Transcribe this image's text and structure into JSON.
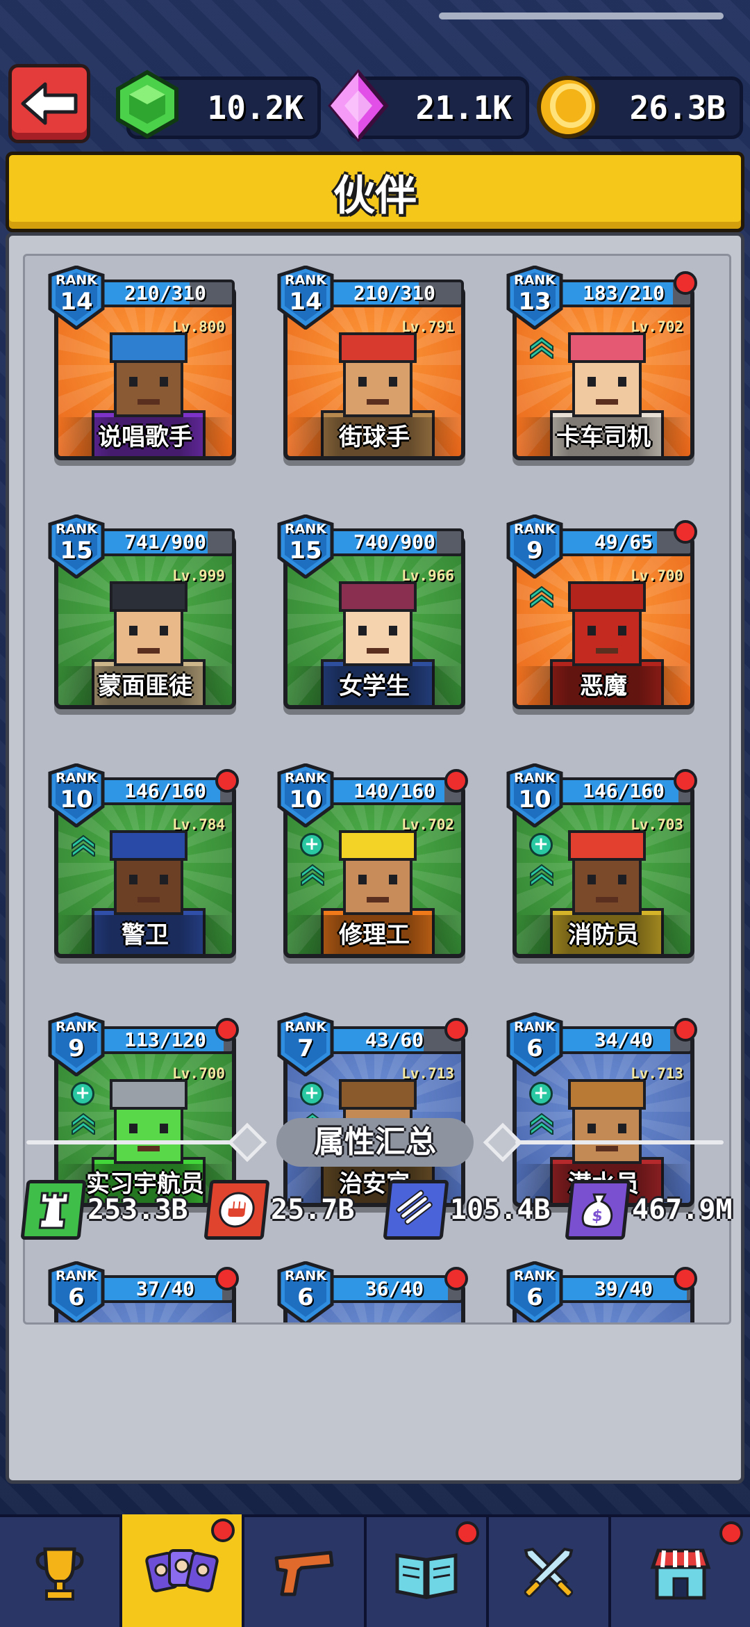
{
  "currencies": {
    "gem": "10.2K",
    "crystal": "21.1K",
    "coin": "26.3B"
  },
  "page_title": "伙伴",
  "rank_label": "RANK",
  "partners": [
    {
      "name": "说唱歌手",
      "rank": "14",
      "progress": "210/310",
      "level": "Lv.800",
      "progress_fraction": 0.68,
      "bg": "orange",
      "red_dot": false,
      "plus": false,
      "chevron": false
    },
    {
      "name": "街球手",
      "rank": "14",
      "progress": "210/310",
      "level": "Lv.791",
      "progress_fraction": 0.68,
      "bg": "orange",
      "red_dot": false,
      "plus": false,
      "chevron": false
    },
    {
      "name": "卡车司机",
      "rank": "13",
      "progress": "183/210",
      "level": "Lv.702",
      "progress_fraction": 0.87,
      "bg": "orange",
      "red_dot": true,
      "plus": false,
      "chevron": true
    },
    {
      "name": "蒙面匪徒",
      "rank": "15",
      "progress": "741/900",
      "level": "Lv.999",
      "progress_fraction": 0.82,
      "bg": "green",
      "red_dot": false,
      "plus": false,
      "chevron": false
    },
    {
      "name": "女学生",
      "rank": "15",
      "progress": "740/900",
      "level": "Lv.966",
      "progress_fraction": 0.82,
      "bg": "green",
      "red_dot": false,
      "plus": false,
      "chevron": false
    },
    {
      "name": "恶魔",
      "rank": "9",
      "progress": "49/65",
      "level": "Lv.700",
      "progress_fraction": 0.75,
      "bg": "orange",
      "red_dot": true,
      "plus": false,
      "chevron": true
    },
    {
      "name": "警卫",
      "rank": "10",
      "progress": "146/160",
      "level": "Lv.784",
      "progress_fraction": 0.91,
      "bg": "green",
      "red_dot": true,
      "plus": false,
      "chevron": true
    },
    {
      "name": "修理工",
      "rank": "10",
      "progress": "140/160",
      "level": "Lv.702",
      "progress_fraction": 0.875,
      "bg": "green",
      "red_dot": true,
      "plus": true,
      "chevron": true
    },
    {
      "name": "消防员",
      "rank": "10",
      "progress": "146/160",
      "level": "Lv.703",
      "progress_fraction": 0.91,
      "bg": "green",
      "red_dot": true,
      "plus": true,
      "chevron": true
    },
    {
      "name": "实习宇航员",
      "rank": "9",
      "progress": "113/120",
      "level": "Lv.700",
      "progress_fraction": 0.94,
      "bg": "green",
      "red_dot": true,
      "plus": true,
      "chevron": true
    },
    {
      "name": "治安官",
      "rank": "7",
      "progress": "43/60",
      "level": "Lv.713",
      "progress_fraction": 0.72,
      "bg": "blue",
      "red_dot": true,
      "plus": true,
      "chevron": true
    },
    {
      "name": "潜水员",
      "rank": "6",
      "progress": "34/40",
      "level": "Lv.713",
      "progress_fraction": 0.85,
      "bg": "blue",
      "red_dot": true,
      "plus": true,
      "chevron": true
    },
    {
      "name": "",
      "rank": "6",
      "progress": "37/40",
      "level": "",
      "progress_fraction": 0.925,
      "bg": "blue",
      "red_dot": true,
      "plus": false,
      "chevron": false
    },
    {
      "name": "",
      "rank": "6",
      "progress": "36/40",
      "level": "",
      "progress_fraction": 0.9,
      "bg": "blue",
      "red_dot": true,
      "plus": false,
      "chevron": false
    },
    {
      "name": "",
      "rank": "6",
      "progress": "39/40",
      "level": "",
      "progress_fraction": 0.975,
      "bg": "blue",
      "red_dot": true,
      "plus": false,
      "chevron": false
    }
  ],
  "stats_title": "属性汇总",
  "stats": [
    {
      "icon": "tower-icon",
      "value": "253.3B",
      "color": "#3fbf4a"
    },
    {
      "icon": "fist-icon",
      "value": "25.7B",
      "color": "#e0442f"
    },
    {
      "icon": "ammo-icon",
      "value": "105.4B",
      "color": "#4b63d9"
    },
    {
      "icon": "money-bag-icon",
      "value": "467.9M",
      "color": "#7a4fd0"
    }
  ],
  "nav": [
    {
      "icon": "trophy-icon",
      "active": false,
      "red_dot": false
    },
    {
      "icon": "partners-cards-icon",
      "active": true,
      "red_dot": true
    },
    {
      "icon": "pistol-icon",
      "active": false,
      "red_dot": false
    },
    {
      "icon": "book-icon",
      "active": false,
      "red_dot": true
    },
    {
      "icon": "crossed-swords-icon",
      "active": false,
      "red_dot": false
    },
    {
      "icon": "shop-icon",
      "active": false,
      "red_dot": true
    }
  ]
}
